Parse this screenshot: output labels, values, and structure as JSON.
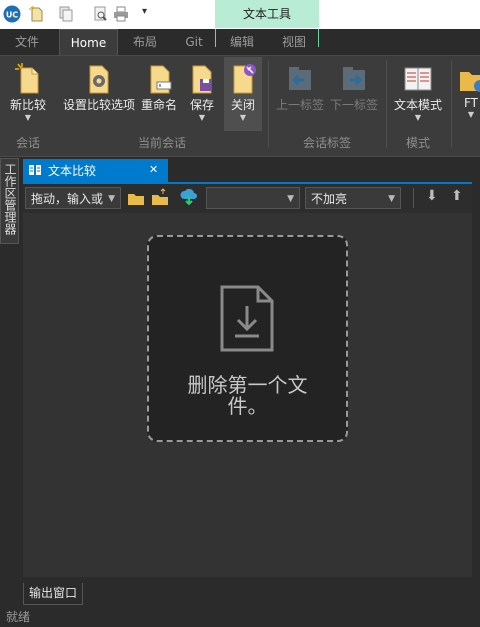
{
  "title_bar": {
    "context_tab": "文本工具",
    "qa_icons": [
      "uc-logo-icon",
      "new-document-icon",
      "copy-document-icon",
      "print-preview-icon",
      "print-icon",
      "customize-quick-access-icon"
    ]
  },
  "tabs": [
    {
      "label": "文件"
    },
    {
      "label": "Home"
    },
    {
      "label": "布局"
    },
    {
      "label": "Git"
    },
    {
      "label": "编辑"
    },
    {
      "label": "视图"
    }
  ],
  "ribbon": {
    "buttons": [
      {
        "label": "新比较",
        "icon": "new-compare-icon",
        "dropdown": true,
        "enabled": true
      },
      {
        "label": "设置比较选项",
        "icon": "compare-options-icon",
        "dropdown": false,
        "enabled": true
      },
      {
        "label": "重命名",
        "icon": "rename-icon",
        "dropdown": false,
        "enabled": true
      },
      {
        "label": "保存",
        "icon": "save-icon",
        "dropdown": true,
        "enabled": true
      },
      {
        "label": "关闭",
        "icon": "close-doc-icon",
        "dropdown": true,
        "enabled": true
      },
      {
        "label": "上一标签",
        "icon": "previous-tab-icon",
        "dropdown": false,
        "enabled": false
      },
      {
        "label": "下一标签",
        "icon": "next-tab-icon",
        "dropdown": false,
        "enabled": false
      },
      {
        "label": "文本模式",
        "icon": "text-mode-icon",
        "dropdown": true,
        "enabled": true
      },
      {
        "label": "FT",
        "icon": "ftp-folder-icon",
        "dropdown": true,
        "enabled": true
      }
    ],
    "groups": [
      {
        "label": "会话"
      },
      {
        "label": "当前会话"
      },
      {
        "label": "会话标签"
      },
      {
        "label": "模式"
      }
    ]
  },
  "side_panel": {
    "label": "工作区管理器"
  },
  "doc_tab": {
    "label": "文本比较",
    "close": "✕"
  },
  "toolbar": {
    "path_combo": "拖动，输入或",
    "path_combo_arrow": "▼",
    "middle_combo": "",
    "encrypt_combo": "不加亮",
    "down_arrow": "⬇",
    "up_arrow": "⬆"
  },
  "dropzone": {
    "text_line1": "删除第一个文",
    "text_line2": "件。"
  },
  "output_tab": {
    "label": "输出窗口"
  },
  "status": {
    "text": "就绪"
  },
  "colors": {
    "accent": "#007acc",
    "context_tab": "#b9ecd4",
    "ribbon": "#3c3c3c",
    "background": "#2b2b2b"
  }
}
